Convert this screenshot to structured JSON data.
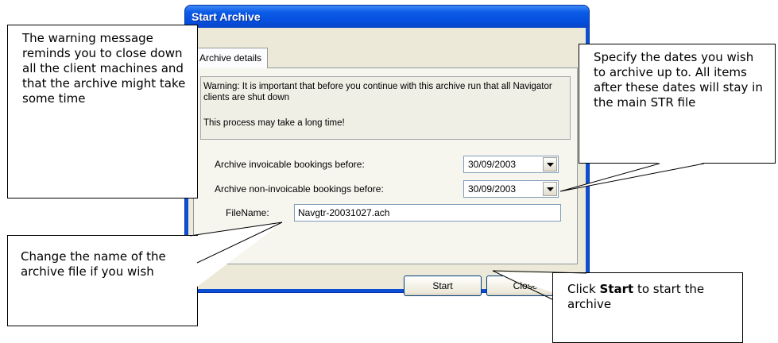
{
  "window": {
    "title": "Start Archive"
  },
  "tab": {
    "label": "Archive details"
  },
  "warning": {
    "line1": "Warning:  It is important that before you continue with this archive run that all Navigator clients are shut down",
    "line2": "This process may take a long time!"
  },
  "invoicable": {
    "label": "Archive invoicable bookings before:",
    "value": "30/09/2003"
  },
  "non_invoicable": {
    "label": "Archive non-invoicable bookings before:",
    "value": "30/09/2003"
  },
  "filename": {
    "label": "FileName:",
    "value": "Navgtr-20031027.ach"
  },
  "buttons": {
    "start": "Start",
    "close": "Close"
  },
  "callouts": {
    "warning": "The warning message reminds you to close down all the client machines and that the archive might take some time",
    "dates": "Specify the dates you wish to archive up to. All items after these dates will stay in the main STR file",
    "filename": "Change the name of the archive file if you wish",
    "start_prefix": "Click ",
    "start_bold": "Start",
    "start_suffix": " to start the archive"
  },
  "icons": {
    "dropdown": "chevron-down-icon"
  }
}
